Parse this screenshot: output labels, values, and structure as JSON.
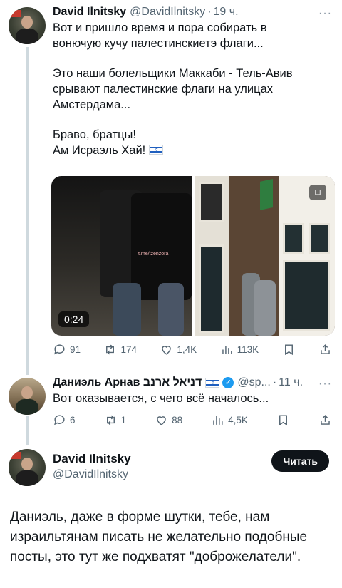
{
  "tweet1": {
    "name": "David Ilnitsky",
    "handle": "@DavidIlnitsky",
    "separator": "·",
    "time": "19 ч.",
    "more": "···",
    "lines": [
      "Вот и пришло время и пора собирать в",
      "вонючую кучу палестинскиетэ флаги...",
      "Это наши болельщики Маккаби - Тель-Авив",
      "срывают палестинские флаги на улицах",
      "Амстердама...",
      "Браво, братцы!",
      "Ам Исраэль Хай!"
    ],
    "video_duration": "0:24",
    "watermark": "t.me/tzenzora",
    "stats": {
      "replies": "91",
      "retweets": "174",
      "likes": "1,4K",
      "views": "113K"
    }
  },
  "tweet2": {
    "name": "Даниэль Арнав דניאל ארנב",
    "handle": "@sp...",
    "separator": "·",
    "time": "11 ч.",
    "more": "···",
    "text": "Вот оказывается, с чего всё началось...",
    "stats": {
      "replies": "6",
      "retweets": "1",
      "likes": "88",
      "views": "4,5K"
    }
  },
  "tweet3": {
    "name": "David Ilnitsky",
    "handle": "@DavidIlnitsky",
    "follow_label": "Читать",
    "text": "Даниэль, даже в форме шутки, тебе, нам израильтянам писать не желательно подобные посты, это тут же подхватят \"доброжелатели\"."
  },
  "icons": [
    "reply-icon",
    "retweet-icon",
    "like-icon",
    "views-icon",
    "bookmark-icon",
    "share-icon",
    "verified-icon",
    "israel-flag-icon"
  ],
  "colors": {
    "text": "#0f1419",
    "secondary": "#536471",
    "verified": "#1d9bf0",
    "button": "#0f1419"
  }
}
